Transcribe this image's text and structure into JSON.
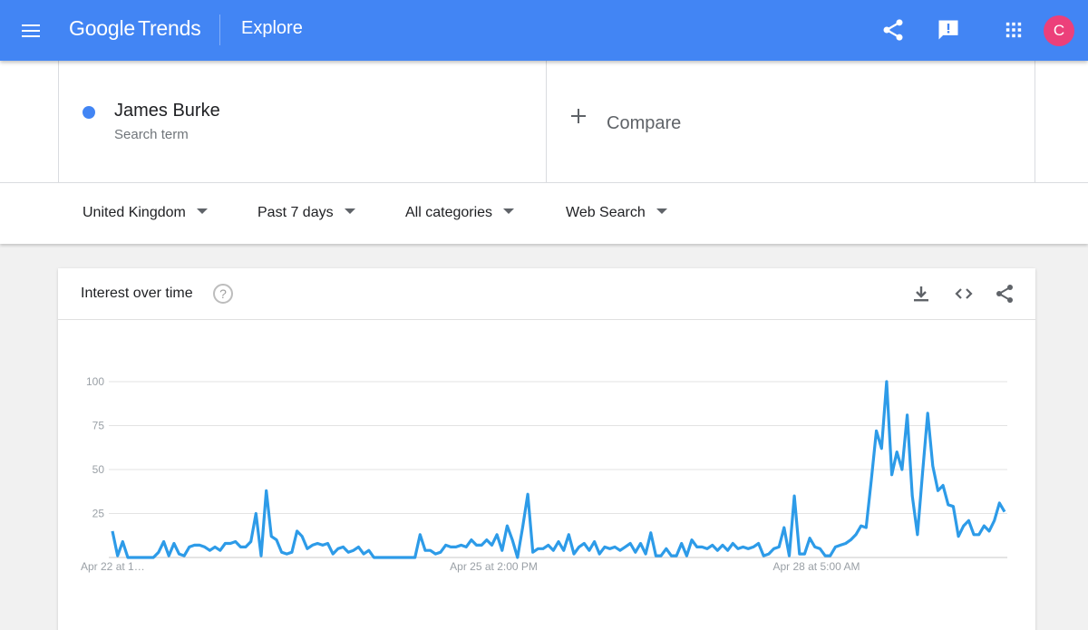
{
  "header": {
    "logo_google": "Google",
    "logo_trends": "Trends",
    "page_title": "Explore",
    "avatar_letter": "C"
  },
  "terms": [
    {
      "name": "James Burke",
      "type": "Search term",
      "color": "#4285f4"
    }
  ],
  "compare_label": "Compare",
  "filters": {
    "region": "United Kingdom",
    "time": "Past 7 days",
    "category": "All categories",
    "property": "Web Search"
  },
  "card": {
    "title": "Interest over time",
    "help": "?"
  },
  "chart_data": {
    "type": "line",
    "title": "Interest over time",
    "ylim": [
      0,
      100
    ],
    "y_ticks": [
      25,
      50,
      75,
      100
    ],
    "x_tick_labels": [
      {
        "label": "Apr 22 at 1…",
        "index": 0
      },
      {
        "label": "Apr 25 at 2:00 PM",
        "index": 72
      },
      {
        "label": "Apr 28 at 5:00 AM",
        "index": 135
      }
    ],
    "line_color": "#2d9be8",
    "series": [
      {
        "values": [
          15,
          1,
          9,
          0,
          0,
          0,
          0,
          0,
          0,
          3,
          9,
          1,
          8,
          2,
          1,
          6,
          7,
          7,
          6,
          4,
          6,
          4,
          8,
          8,
          9,
          6,
          6,
          9,
          25,
          1,
          38,
          12,
          10,
          3,
          2,
          3,
          15,
          12,
          5,
          7,
          8,
          7,
          8,
          2,
          5,
          6,
          3,
          4,
          6,
          2,
          4,
          0,
          0,
          0,
          0,
          0,
          0,
          0,
          0,
          0,
          13,
          4,
          4,
          2,
          3,
          7,
          6,
          6,
          7,
          6,
          10,
          7,
          7,
          10,
          7,
          13,
          4,
          18,
          10,
          0,
          17,
          36,
          3,
          5,
          5,
          7,
          4,
          9,
          4,
          13,
          2,
          6,
          8,
          4,
          9,
          2,
          6,
          5,
          6,
          4,
          6,
          8,
          3,
          8,
          2,
          14,
          1,
          1,
          5,
          1,
          1,
          8,
          1,
          10,
          6,
          6,
          5,
          7,
          4,
          7,
          4,
          8,
          5,
          6,
          5,
          6,
          8,
          1,
          2,
          5,
          6,
          17,
          1,
          35,
          2,
          2,
          11,
          6,
          5,
          1,
          1,
          6,
          7,
          8,
          10,
          13,
          18,
          17,
          44,
          72,
          62,
          100,
          47,
          60,
          50,
          81,
          35,
          13,
          48,
          82,
          52,
          38,
          41,
          30,
          29,
          12,
          18,
          21,
          13,
          13,
          18,
          15,
          21,
          31,
          26
        ]
      }
    ]
  }
}
